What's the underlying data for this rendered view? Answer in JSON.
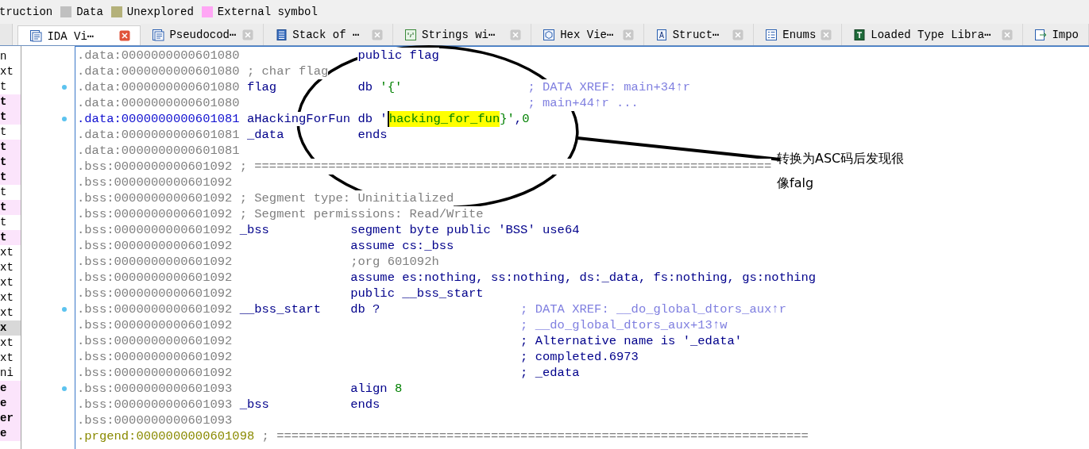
{
  "legend": [
    {
      "label": "truction"
    },
    {
      "label": "Data",
      "color": "#c0c0c0"
    },
    {
      "label": "Unexplored",
      "color": "#b4b17a"
    },
    {
      "label": "External symbol",
      "color": "#ffa6f5"
    }
  ],
  "tabs": [
    {
      "label": "IDA Vi⋯",
      "kind": "disasm",
      "selected": true
    },
    {
      "label": "Pseudocod⋯",
      "kind": "pseudo",
      "selected": false
    },
    {
      "label": "Stack of ⋯",
      "kind": "stack",
      "selected": false
    },
    {
      "label": "Strings wi⋯",
      "kind": "strings",
      "selected": false
    },
    {
      "label": "Hex Vie⋯",
      "kind": "hex",
      "selected": false
    },
    {
      "label": "Struct⋯",
      "kind": "struct",
      "selected": false
    },
    {
      "label": "Enums",
      "kind": "enums",
      "selected": false
    },
    {
      "label": "Loaded Type Libra⋯",
      "kind": "til",
      "selected": false
    },
    {
      "label": "Impo",
      "kind": "imports",
      "selected": false
    }
  ],
  "side_list": [
    {
      "text": "n",
      "external": false,
      "selected": false
    },
    {
      "text": "xt",
      "external": false,
      "selected": false
    },
    {
      "text": "t",
      "external": false,
      "selected": false
    },
    {
      "text": "t",
      "external": true,
      "selected": false
    },
    {
      "text": "t",
      "external": true,
      "selected": false
    },
    {
      "text": "t",
      "external": false,
      "selected": false
    },
    {
      "text": "t",
      "external": true,
      "selected": false
    },
    {
      "text": "t",
      "external": true,
      "selected": false
    },
    {
      "text": "t",
      "external": true,
      "selected": false
    },
    {
      "text": "t",
      "external": false,
      "selected": false
    },
    {
      "text": "t",
      "external": true,
      "selected": false
    },
    {
      "text": "t",
      "external": false,
      "selected": false
    },
    {
      "text": "t",
      "external": true,
      "selected": false
    },
    {
      "text": "xt",
      "external": false,
      "selected": false
    },
    {
      "text": "xt",
      "external": false,
      "selected": false
    },
    {
      "text": "xt",
      "external": false,
      "selected": false
    },
    {
      "text": "xt",
      "external": false,
      "selected": false
    },
    {
      "text": "xt",
      "external": false,
      "selected": false
    },
    {
      "text": "x",
      "external": false,
      "selected": true
    },
    {
      "text": "xt",
      "external": false,
      "selected": false
    },
    {
      "text": "xt",
      "external": false,
      "selected": false
    },
    {
      "text": "ni",
      "external": false,
      "selected": false
    },
    {
      "text": "e",
      "external": true,
      "selected": false
    },
    {
      "text": "e",
      "external": true,
      "selected": false
    },
    {
      "text": "er",
      "external": true,
      "selected": false
    },
    {
      "text": "e",
      "external": true,
      "selected": false
    }
  ],
  "lines": [
    {
      "address": ".data:0000000000601080",
      "kind": "normal",
      "marked": false,
      "op": [
        {
          "text": "public flag",
          "kind": "kw"
        }
      ]
    },
    {
      "address": ".data:0000000000601080",
      "kind": "normal",
      "marked": false,
      "note": "; char flag"
    },
    {
      "address": ".data:0000000000601080",
      "kind": "normal",
      "marked": true,
      "label": "flag",
      "op": [
        {
          "text": "db ",
          "kind": "kw"
        },
        {
          "text": "'{'",
          "kind": "str"
        }
      ],
      "comment": {
        "text": "; DATA XREF: main+34↑r",
        "kind": "xref"
      }
    },
    {
      "address": ".data:0000000000601080",
      "kind": "normal",
      "marked": false,
      "comment": {
        "text": "; main+44↑r ...",
        "kind": "xref"
      }
    },
    {
      "address": ".data:0000000000601081",
      "kind": "current",
      "marked": true,
      "label": "aHackingForFun",
      "op": [
        {
          "text": "db '",
          "kind": "kw"
        },
        {
          "text": "hacking_for_fun",
          "kind": "highlight"
        },
        {
          "text": "}'",
          "kind": "str"
        },
        {
          "text": ",",
          "kind": "kw"
        },
        {
          "text": "0",
          "kind": "num"
        }
      ]
    },
    {
      "address": ".data:0000000000601081",
      "kind": "normal",
      "marked": false,
      "label": "_data",
      "op": [
        {
          "text": "ends",
          "kind": "kw"
        }
      ]
    },
    {
      "address": ".data:0000000000601081",
      "kind": "normal",
      "marked": false
    },
    {
      "address": ".bss:0000000000601092",
      "kind": "normal",
      "marked": false,
      "note": "; ======================================================================"
    },
    {
      "address": ".bss:0000000000601092",
      "kind": "normal",
      "marked": false
    },
    {
      "address": ".bss:0000000000601092",
      "kind": "normal",
      "marked": false,
      "note": "; Segment type: Uninitialized"
    },
    {
      "address": ".bss:0000000000601092",
      "kind": "normal",
      "marked": false,
      "note": "; Segment permissions: Read/Write"
    },
    {
      "address": ".bss:0000000000601092",
      "kind": "normal",
      "marked": false,
      "label": "_bss",
      "op": [
        {
          "text": "segment byte public 'BSS' use64",
          "kind": "kw"
        }
      ]
    },
    {
      "address": ".bss:0000000000601092",
      "kind": "normal",
      "marked": false,
      "op": [
        {
          "text": "assume cs:_bss",
          "kind": "kw"
        }
      ]
    },
    {
      "address": ".bss:0000000000601092",
      "kind": "normal",
      "marked": false,
      "op": [
        {
          "text": ";org 601092h",
          "kind": "comment"
        }
      ]
    },
    {
      "address": ".bss:0000000000601092",
      "kind": "normal",
      "marked": false,
      "op": [
        {
          "text": "assume es:nothing, ss:nothing, ds:_data, fs:nothing, gs:nothing",
          "kind": "kw"
        }
      ]
    },
    {
      "address": ".bss:0000000000601092",
      "kind": "normal",
      "marked": false,
      "op": [
        {
          "text": "public __bss_start",
          "kind": "kw"
        }
      ]
    },
    {
      "address": ".bss:0000000000601092",
      "kind": "normal",
      "marked": true,
      "label": "__bss_start",
      "op": [
        {
          "text": "db ?",
          "kind": "kw"
        }
      ],
      "comment": {
        "text": "; DATA XREF: __do_global_dtors_aux↑r",
        "kind": "xref"
      }
    },
    {
      "address": ".bss:0000000000601092",
      "kind": "normal",
      "marked": false,
      "comment": {
        "text": "; __do_global_dtors_aux+13↑w",
        "kind": "xref"
      }
    },
    {
      "address": ".bss:0000000000601092",
      "kind": "normal",
      "marked": false,
      "comment": {
        "text": "; Alternative name is '_edata'",
        "kind": "ref"
      }
    },
    {
      "address": ".bss:0000000000601092",
      "kind": "normal",
      "marked": false,
      "comment": {
        "text": "; completed.6973",
        "kind": "ref"
      }
    },
    {
      "address": ".bss:0000000000601092",
      "kind": "normal",
      "marked": false,
      "comment": {
        "text": "; _edata",
        "kind": "ref"
      }
    },
    {
      "address": ".bss:0000000000601093",
      "kind": "normal",
      "marked": true,
      "op": [
        {
          "text": "align ",
          "kind": "kw"
        },
        {
          "text": "8",
          "kind": "num"
        }
      ]
    },
    {
      "address": ".bss:0000000000601093",
      "kind": "normal",
      "marked": false,
      "label": "_bss",
      "op": [
        {
          "text": "ends",
          "kind": "kw"
        }
      ]
    },
    {
      "address": ".bss:0000000000601093",
      "kind": "normal",
      "marked": false
    },
    {
      "address": ".prgend:0000000000601098",
      "kind": "end",
      "marked": false,
      "note": "; ========================================================================"
    }
  ],
  "annotation": {
    "lines": [
      "转换为ASC码后发现很",
      "像falg"
    ]
  }
}
